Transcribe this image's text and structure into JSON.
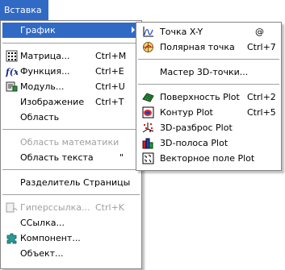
{
  "menubar": {
    "label": "Вставка"
  },
  "main_menu": {
    "graph": {
      "label": "График"
    },
    "matrix": {
      "label": "Матрица...",
      "shortcut": "Ctrl+M"
    },
    "function": {
      "label": "Функция...",
      "shortcut": "Ctrl+E"
    },
    "module": {
      "label": "Модуль...",
      "shortcut": "Ctrl+U"
    },
    "image": {
      "label": "Изображение",
      "shortcut": "Ctrl+T"
    },
    "region": {
      "label": "Область"
    },
    "math_region": {
      "label": "Область математики"
    },
    "text_region": {
      "label": "Область текста",
      "shortcut": "\""
    },
    "page_break": {
      "label": "Разделитель Страницы"
    },
    "hyperlink": {
      "label": "Гиперссылка...",
      "shortcut": "Ctrl+K"
    },
    "reference": {
      "label": "ССылка..."
    },
    "component": {
      "label": "Компонент..."
    },
    "object": {
      "label": "Объект..."
    }
  },
  "sub_menu": {
    "xy_plot": {
      "label": "Точка X-Y",
      "shortcut": "@"
    },
    "polar_plot": {
      "label": "Полярная точка",
      "shortcut": "Ctrl+7"
    },
    "wizard_3d": {
      "label": "Мастер 3D-точки..."
    },
    "surface_plot": {
      "label": "Поверхность Plot",
      "shortcut": "Ctrl+2"
    },
    "contour_plot": {
      "label": "Контур Plot",
      "shortcut": "Ctrl+5"
    },
    "scatter_3d": {
      "label": "3D-разброс Plot"
    },
    "bar_3d": {
      "label": "3D-полоса Plot"
    },
    "vector_field": {
      "label": "Векторное поле Plot"
    }
  },
  "colors": {
    "highlight": "#316ac5",
    "disabled": "#a0a0a0"
  },
  "icons": [
    "matrix-icon",
    "function-icon",
    "module-icon",
    "component-icon",
    "xy-plot-icon",
    "polar-plot-icon",
    "surface-plot-icon",
    "contour-plot-icon",
    "scatter-3d-icon",
    "bar-3d-icon",
    "vector-field-icon"
  ]
}
